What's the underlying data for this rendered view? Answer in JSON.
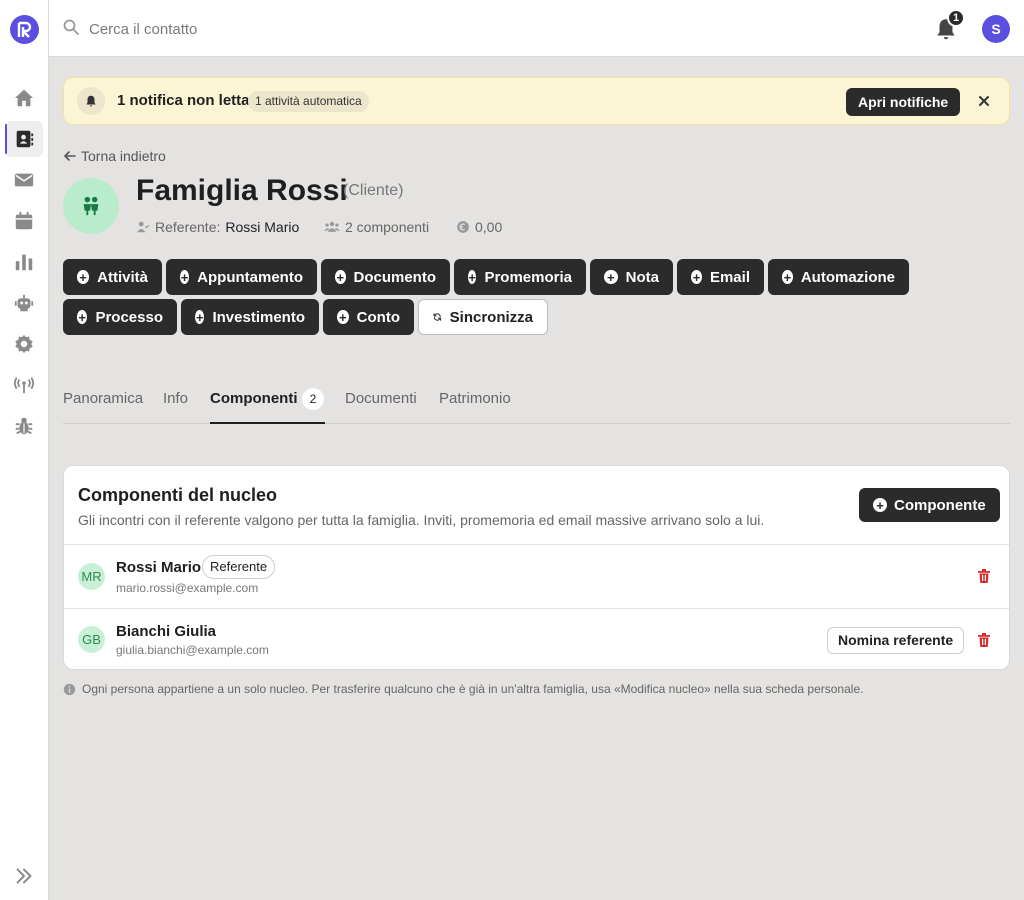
{
  "sidebar": {
    "logo": "R",
    "items": [
      {
        "icon": "home-icon",
        "active": false
      },
      {
        "icon": "contacts-icon",
        "active": true
      },
      {
        "icon": "mail-icon",
        "active": false
      },
      {
        "icon": "calendar-icon",
        "active": false
      },
      {
        "icon": "chart-icon",
        "active": false
      },
      {
        "icon": "robot-icon",
        "active": false
      },
      {
        "icon": "gear-icon",
        "active": false
      },
      {
        "icon": "antenna-icon",
        "active": false
      },
      {
        "icon": "bug-icon",
        "active": false
      }
    ],
    "expand_icon": "double-chevron-right-icon"
  },
  "topbar": {
    "search_placeholder": "Cerca il contatto",
    "notification_count": "1",
    "user_initial": "S"
  },
  "banner": {
    "title": "1 notifica non letta",
    "chip": "1 attività automatica",
    "open_label": "Apri notifiche",
    "close_label": "✕"
  },
  "header": {
    "back_label": "Torna indietro",
    "title": "Famiglia Rossi",
    "subtitle": "(Cliente)",
    "referent_label": "Referente:",
    "referent_name": "Rossi Mario",
    "components": "2 componenti",
    "balance": "0,00"
  },
  "actions": {
    "row1": [
      "Attività",
      "Appuntamento",
      "Documento",
      "Promemoria",
      "Nota",
      "Email",
      "Automazione"
    ],
    "row2": [
      "Processo",
      "Investimento",
      "Conto"
    ],
    "sync_label": "Sincronizza"
  },
  "tabs": {
    "items": [
      "Panoramica",
      "Info",
      "Componenti",
      "Documenti",
      "Patrimonio"
    ],
    "active": "Componenti",
    "badge": "2"
  },
  "card": {
    "title": "Componenti del nucleo",
    "description": "Gli incontri con il referente valgono per tutta la famiglia. Inviti, promemoria ed email massive arrivano solo a lui.",
    "add_label": "Componente",
    "members": [
      {
        "initials": "MR",
        "name": "Rossi Mario",
        "email": "mario.rossi@example.com",
        "role": "Referente"
      },
      {
        "initials": "GB",
        "name": "Bianchi Giulia",
        "email": "giulia.bianchi@example.com",
        "action": "Nomina referente"
      }
    ]
  },
  "footnote": "Ogni persona appartiene a un solo nucleo. Per trasferire qualcuno che è già in un'altra famiglia, usa «Modifica nucleo» nella sua scheda personale.",
  "colors": {
    "accent": "#5b4fe0",
    "dark_button": "#2b2b2b",
    "banner_bg": "#fbf5d6",
    "member_avatar_bg": "#c8f0d6",
    "danger": "#d32f2f"
  }
}
